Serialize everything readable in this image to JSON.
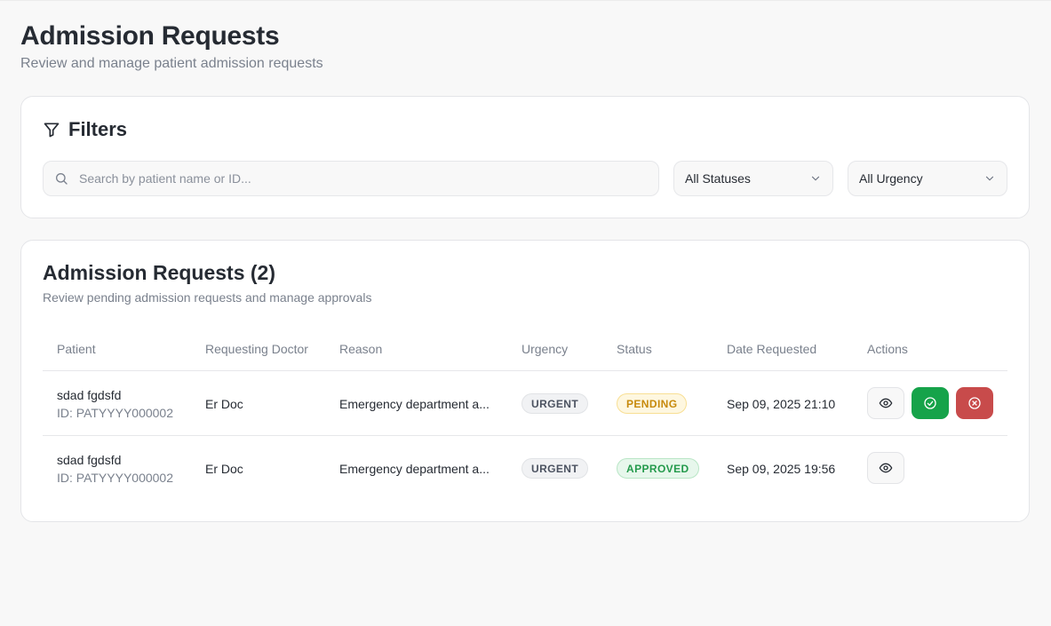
{
  "page": {
    "title": "Admission Requests",
    "subtitle": "Review and manage patient admission requests"
  },
  "filters": {
    "title": "Filters",
    "search_placeholder": "Search by patient name or ID...",
    "status_selected": "All Statuses",
    "urgency_selected": "All Urgency"
  },
  "table": {
    "title": "Admission Requests (2)",
    "subtitle": "Review pending admission requests and manage approvals",
    "columns": [
      "Patient",
      "Requesting Doctor",
      "Reason",
      "Urgency",
      "Status",
      "Date Requested",
      "Actions"
    ],
    "rows": [
      {
        "patient_name": "sdad fgdsfd",
        "patient_id": "ID: PATYYYY000002",
        "doctor": "Er Doc",
        "reason": "Emergency department a...",
        "urgency": "URGENT",
        "status": "PENDING",
        "date": "Sep 09, 2025 21:10",
        "actions": [
          "view",
          "approve",
          "reject"
        ]
      },
      {
        "patient_name": "sdad fgdsfd",
        "patient_id": "ID: PATYYYY000002",
        "doctor": "Er Doc",
        "reason": "Emergency department a...",
        "urgency": "URGENT",
        "status": "APPROVED",
        "date": "Sep 09, 2025 19:56",
        "actions": [
          "view"
        ]
      }
    ]
  },
  "icons": {
    "filter": "filter-icon",
    "search": "search-icon",
    "chevron": "chevron-down-icon",
    "view": "eye-icon",
    "approve": "check-circle-icon",
    "reject": "x-circle-icon"
  },
  "colors": {
    "approve": "#16a34a",
    "reject": "#c84b4b",
    "pending": "#c78a0c",
    "approved": "#249a4c"
  }
}
